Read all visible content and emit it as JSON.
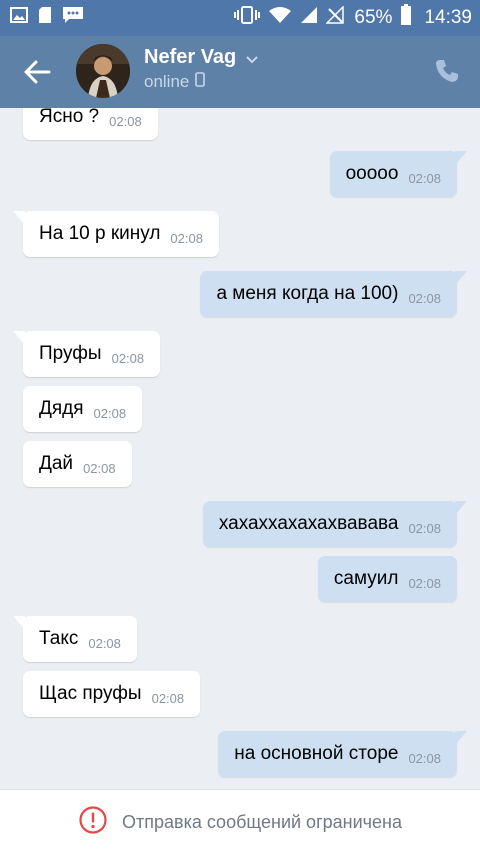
{
  "statusbar": {
    "battery": "65%",
    "time": "14:39"
  },
  "header": {
    "contact_name": "Nefer Vag",
    "status": "online"
  },
  "messages": [
    {
      "dir": "in",
      "text": "Ясно ?",
      "time": "02:08"
    },
    {
      "dir": "out",
      "text": "ооооо",
      "time": "02:08"
    },
    {
      "dir": "in",
      "text": "На 10 р кинул",
      "time": "02:08"
    },
    {
      "dir": "out",
      "text": "а меня когда на 100)",
      "time": "02:08"
    },
    {
      "dir": "in",
      "text": "Пруфы",
      "time": "02:08"
    },
    {
      "dir": "in",
      "text": "Дядя",
      "time": "02:08"
    },
    {
      "dir": "in",
      "text": "Дай",
      "time": "02:08"
    },
    {
      "dir": "out",
      "text": "хахаххахахахвавава",
      "time": "02:08"
    },
    {
      "dir": "out",
      "text": "самуил",
      "time": "02:08"
    },
    {
      "dir": "in",
      "text": "Такс",
      "time": "02:08"
    },
    {
      "dir": "in",
      "text": "Щас пруфы",
      "time": "02:08"
    },
    {
      "dir": "out",
      "text": "на основной сторе",
      "time": "02:08"
    }
  ],
  "footer": {
    "notice": "Отправка сообщений ограничена"
  },
  "colors": {
    "header": "#5e81a8",
    "statusbar": "#5077a9",
    "incoming": "#ffffff",
    "outgoing": "#cfdff2",
    "warning": "#e64646"
  }
}
